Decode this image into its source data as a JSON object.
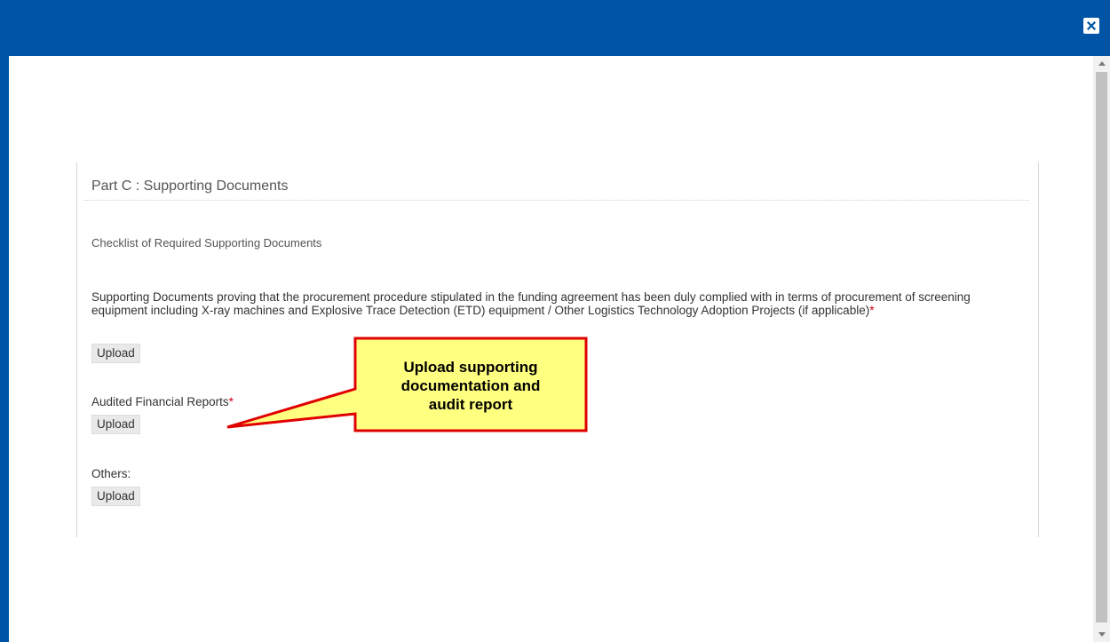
{
  "header": {
    "close_icon": "close-icon"
  },
  "colors": {
    "brand": "#0054a6",
    "required": "#d0021b",
    "callout_fill": "#ffff80",
    "callout_border": "#e10000"
  },
  "panel": {
    "title": "Part C : Supporting Documents",
    "checklist_title": "Checklist of Required Supporting Documents",
    "fields": [
      {
        "label": "Supporting Documents proving that the procurement procedure stipulated in the funding agreement has been duly complied with in terms of procurement of screening equipment including X-ray machines and Explosive Trace Detection (ETD) equipment / Other Logistics Technology Adoption Projects (if applicable)",
        "required_mark": "*",
        "button_label": "Upload"
      },
      {
        "label": "Audited Financial Reports",
        "required_mark": "*",
        "button_label": "Upload"
      },
      {
        "label": "Others:",
        "required_mark": "",
        "button_label": "Upload"
      }
    ]
  },
  "callout": {
    "text": "Upload supporting\ndocumentation and\naudit report"
  }
}
